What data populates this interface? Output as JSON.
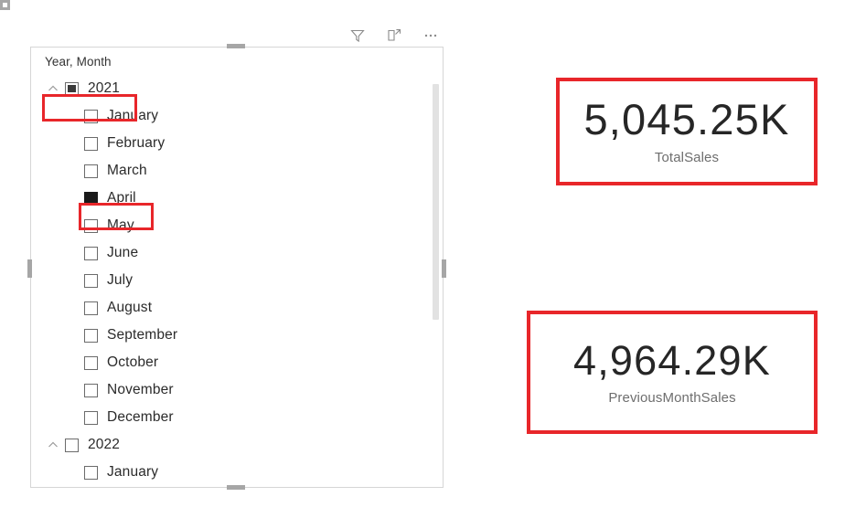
{
  "slicer": {
    "title": "Year, Month",
    "header_icons": [
      {
        "name": "filter-icon",
        "label": "Filters"
      },
      {
        "name": "focus-mode-icon",
        "label": "Focus mode"
      },
      {
        "name": "more-options-icon",
        "label": "More options"
      }
    ],
    "rows": [
      {
        "label": "2021",
        "level": "year",
        "state": "partial",
        "expanded": true,
        "highlighted": true
      },
      {
        "label": "January",
        "level": "month",
        "state": "unchecked",
        "highlighted": false
      },
      {
        "label": "February",
        "level": "month",
        "state": "unchecked",
        "highlighted": false
      },
      {
        "label": "March",
        "level": "month",
        "state": "unchecked",
        "highlighted": false
      },
      {
        "label": "April",
        "level": "month",
        "state": "checked",
        "highlighted": true
      },
      {
        "label": "May",
        "level": "month",
        "state": "unchecked",
        "highlighted": false
      },
      {
        "label": "June",
        "level": "month",
        "state": "unchecked",
        "highlighted": false
      },
      {
        "label": "July",
        "level": "month",
        "state": "unchecked",
        "highlighted": false
      },
      {
        "label": "August",
        "level": "month",
        "state": "unchecked",
        "highlighted": false
      },
      {
        "label": "September",
        "level": "month",
        "state": "unchecked",
        "highlighted": false
      },
      {
        "label": "October",
        "level": "month",
        "state": "unchecked",
        "highlighted": false
      },
      {
        "label": "November",
        "level": "month",
        "state": "unchecked",
        "highlighted": false
      },
      {
        "label": "December",
        "level": "month",
        "state": "unchecked",
        "highlighted": false
      },
      {
        "label": "2022",
        "level": "year",
        "state": "unchecked",
        "expanded": true,
        "highlighted": false
      },
      {
        "label": "January",
        "level": "month",
        "state": "unchecked",
        "highlighted": false
      }
    ]
  },
  "cards": [
    {
      "value": "5,045.25K",
      "label": "TotalSales"
    },
    {
      "value": "4,964.29K",
      "label": "PreviousMonthSales"
    }
  ],
  "colors": {
    "highlight": "#e8262a",
    "value_text": "#262626",
    "label_text": "#6e6e6e",
    "visual_border": "#d6d6d6"
  }
}
